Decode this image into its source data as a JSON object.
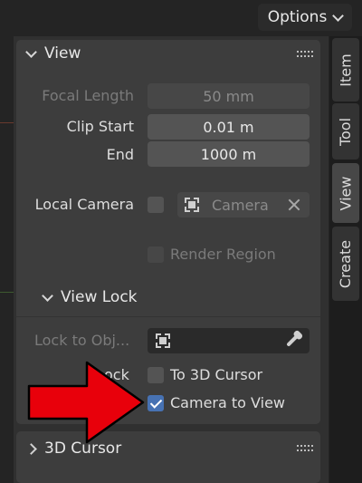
{
  "header": {
    "options_label": "Options"
  },
  "tabs": [
    {
      "label": "Item",
      "active": false
    },
    {
      "label": "Tool",
      "active": false
    },
    {
      "label": "View",
      "active": true
    },
    {
      "label": "Create",
      "active": false
    }
  ],
  "view": {
    "title": "View",
    "focal_length_label": "Focal Length",
    "focal_length_value": "50 mm",
    "clip_start_label": "Clip Start",
    "clip_start_value": "0.01 m",
    "end_label": "End",
    "end_value": "1000 m",
    "local_camera_label": "Local Camera",
    "camera_placeholder": "Camera",
    "render_region_label": "Render Region"
  },
  "view_lock": {
    "title": "View Lock",
    "lock_to_object_label": "Lock to Obj...",
    "lock_label_partial": "ock",
    "to_3d_cursor_label": "To 3D Cursor",
    "camera_to_view_label": "Camera to View",
    "camera_to_view_checked": true
  },
  "cursor_3d": {
    "title": "3D Cursor"
  },
  "colors": {
    "accent": "#4772b3",
    "arrow": "#e8000b"
  }
}
